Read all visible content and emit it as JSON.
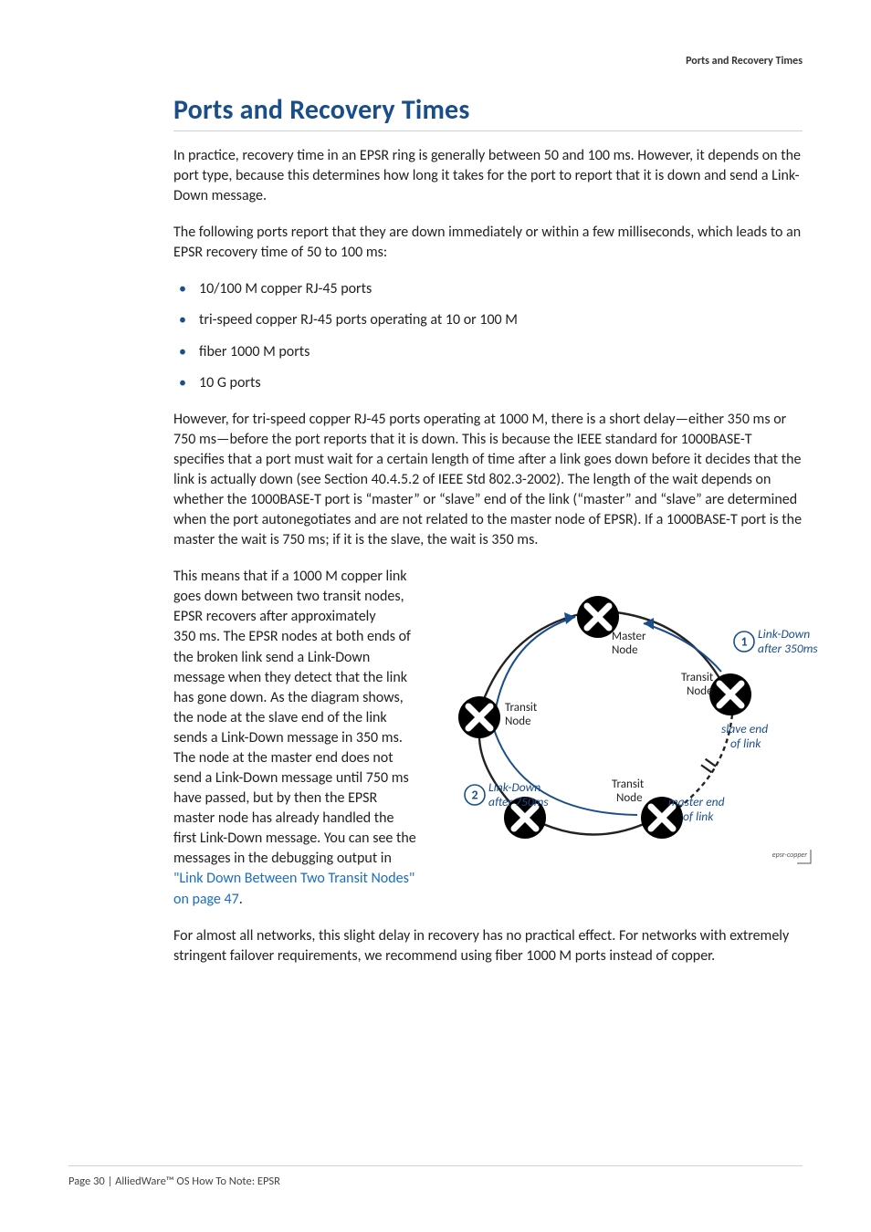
{
  "running_head": "Ports and Recovery Times",
  "title": "Ports and Recovery Times",
  "p1": "In practice, recovery time in an EPSR ring is generally between 50 and 100 ms. However, it depends on the port type, because this determines how long it takes for the port to report that it is down and send a Link-Down message.",
  "p2": "The following ports report that they are down immediately or within a few milliseconds, which leads to an EPSR recovery time of 50 to 100 ms:",
  "bullets": [
    "10/100 M copper RJ-45 ports",
    "tri-speed copper RJ-45 ports operating at 10 or 100 M",
    "fiber 1000 M ports",
    "10 G ports"
  ],
  "p3": "However, for tri-speed copper RJ-45 ports operating at 1000 M, there is a short delay—either 350 ms or 750 ms—before the port reports that it is down. This is because the IEEE standard for 1000BASE-T specifies that a port must wait for a certain length of time after a link goes down before it decides that the link is actually down (see Section 40.4.5.2 of IEEE Std 802.3-2002). The length of the wait depends on whether the 1000BASE-T port is “master” or “slave” end of the link (“master” and “slave” are determined when the port autonegotiates and are not related to the master node of EPSR). If a 1000BASE-T port is the master the wait is 750 ms; if it is the slave, the wait is 350 ms.",
  "p4a": "This means that if a 1000 M copper link goes down between two transit nodes, EPSR recovers after approximately 350 ms. The EPSR nodes at both ends of the broken link send a Link-Down message when they detect that the link has gone down. As the diagram shows, the node at the slave end of the link sends a Link-Down message in 350 ms. The node at the master end does not send a Link-Down message until 750 ms have passed, but by then the EPSR master node has already handled the first Link-Down message. You can see the messages in the debugging output in ",
  "p4_link": "\"Link Down Between Two Transit Nodes\" on page 47",
  "p4b": ".",
  "p5": "For almost all networks, this slight delay in recovery has no practical effect. For networks with extremely stringent failover requirements, we recommend using fiber 1000 M ports instead of copper.",
  "footer": "Page 30 | AlliedWare™ OS How To Note: EPSR",
  "diagram": {
    "master_l1": "Master",
    "master_l2": "Node",
    "transit_l1": "Transit",
    "transit_l2": "Node",
    "slave_l1": "slave end",
    "slave_l2": "of link",
    "mastend_l1": "master end",
    "mastend_l2": "of link",
    "ld1_l1": "Link-Down",
    "ld1_l2": "after 350ms",
    "ld2_l1": "Link-Down",
    "ld2_l2": "after 750ms",
    "n1": "1",
    "n2": "2",
    "corner": "epsr-copper"
  }
}
